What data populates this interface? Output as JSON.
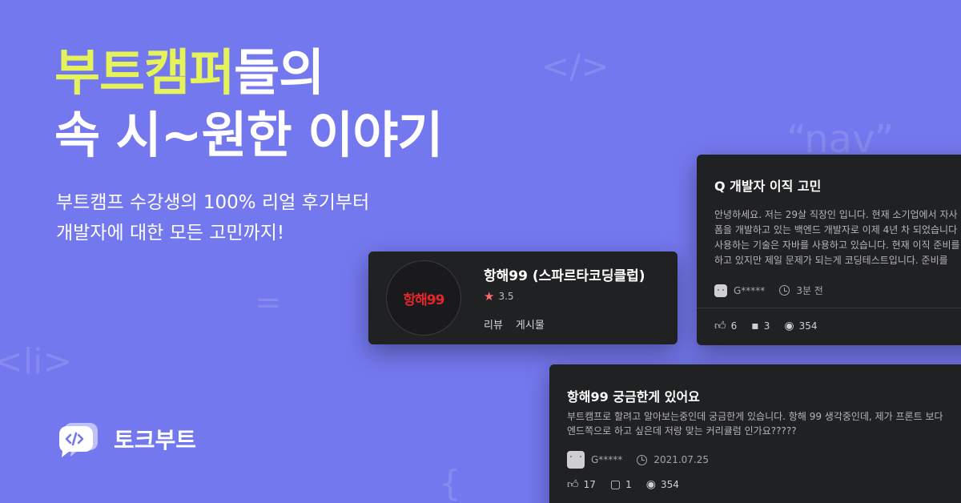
{
  "decor": {
    "code_tag": "</>",
    "nav": "“nav”",
    "equals": "=",
    "li_tag": "<li>",
    "brace": "{"
  },
  "headline": {
    "line1_highlight": "부트캠퍼",
    "line1_rest": "들의",
    "line2": "속 시~원한 이야기"
  },
  "subtitle": {
    "line1": "부트캠프 수강생의 100% 리얼 후기부터",
    "line2": "개발자에 대한 모든 고민까지!"
  },
  "brand": {
    "logo_icon": "chat-bubble-code-icon",
    "name": "토크부트"
  },
  "company_card": {
    "logo_text": "항해99",
    "name": "항해99 (스파르타코딩클럽)",
    "rating": "3.5",
    "tabs": [
      "리뷰",
      "게시물"
    ]
  },
  "post_card": {
    "title": "Q  개발자 이직 고민",
    "body": [
      "안녕하세요. 저는 29살 직장인 입니다. 현재 소기업에서 자사",
      "폼을 개발하고 있는 백엔드 개발자로 이제 4년 차 되었습니다",
      "사용하는 기술은 자바를 사용하고 있습니다. 현재 이직 준비를",
      "하고 있지만 제일 문제가 되는게 코딩테스트입니다. 준비를"
    ],
    "author": "G*****",
    "time": "3분 전",
    "likes": "6",
    "comments": "3",
    "views": "354"
  },
  "question_card": {
    "title": "항해99 궁금한게 있어요",
    "body": [
      "부트캠프로 할려고 알아보는중인데 궁금한게 있습니다. 항해 99 생각중인데, 제가 프론트 보다",
      "엔드쪽으로 하고 싶은데 저랑 맞는 커리큘럼 인가요?????"
    ],
    "author": "G*****",
    "date": "2021.07.25",
    "likes": "17",
    "comments": "1",
    "views": "354"
  },
  "colors": {
    "background": "#7478ee",
    "highlight": "#e6f25a",
    "card": "#202123",
    "star": "#ff6b6b",
    "logo_red": "#e3262b"
  }
}
